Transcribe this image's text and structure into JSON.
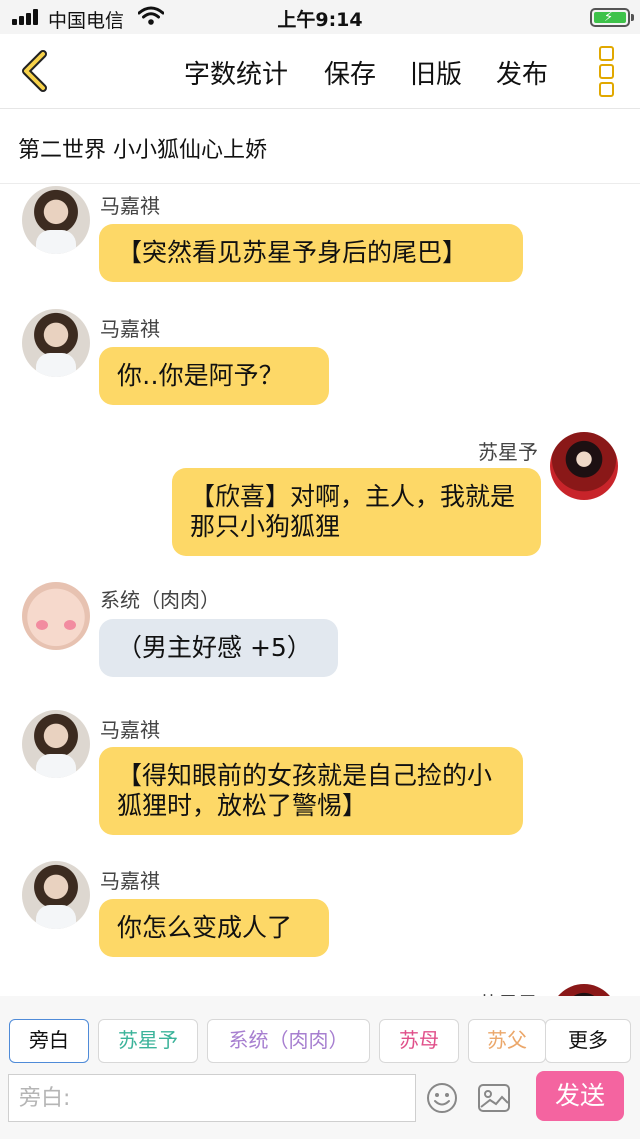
{
  "status_bar": {
    "carrier": "中国电信",
    "time": "上午9:14"
  },
  "nav": {
    "word_count": "字数统计",
    "save": "保存",
    "old_version": "旧版",
    "publish": "发布"
  },
  "chapter_title": "第二世界  小小狐仙心上娇",
  "messages": [
    {
      "sender": "马嘉祺",
      "text": "【突然看见苏星予身后的尾巴】"
    },
    {
      "sender": "马嘉祺",
      "text": "你‥你是阿予？"
    },
    {
      "sender": "苏星予",
      "text": "【欣喜】对啊，主人，我就是那只小狗狐狸"
    },
    {
      "sender": "系统（肉肉）",
      "text": "（男主好感 +5）"
    },
    {
      "sender": "马嘉祺",
      "text": "【得知眼前的女孩就是自己捡的小狐狸时，放松了警惕】"
    },
    {
      "sender": "马嘉祺",
      "text": "你怎么变成人了"
    },
    {
      "sender": "苏星予",
      "text": ""
    }
  ],
  "roles": [
    "旁白",
    "苏星予",
    "系统（肉肉）",
    "苏母",
    "苏父",
    "更多"
  ],
  "role_colors": {
    "苏星予": "#3bb39a",
    "系统（肉肉）": "#a77fd0",
    "苏母": "#e0508a",
    "苏父": "#eba76a",
    "旁白": "#111111",
    "更多": "#111111"
  },
  "input": {
    "placeholder": "旁白:",
    "value": ""
  },
  "send_label": "发送",
  "colors": {
    "accent_yellow": "#fdd867",
    "system_bubble": "#e2e8ef",
    "send_pink": "#f464a0",
    "more_icon": "#e1a800"
  }
}
